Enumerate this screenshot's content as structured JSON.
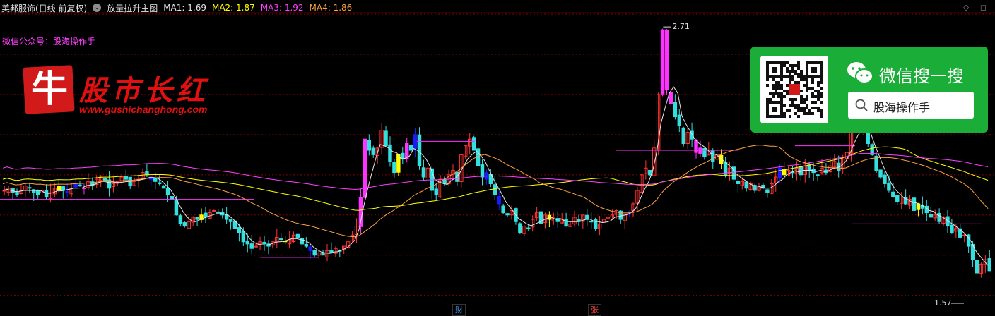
{
  "header": {
    "stock": "美邦服饰(日线 前复权)",
    "icon": "chevron-circle-icon",
    "indicator": "放量拉升主图",
    "ma": [
      {
        "label": "MA1: 1.69",
        "color": "#e6e6e6"
      },
      {
        "label": "MA2: 1.87",
        "color": "#ffff00"
      },
      {
        "label": "MA3: 1.92",
        "color": "#ff40ff"
      },
      {
        "label": "MA4: 1.86",
        "color": "#ffa040"
      }
    ]
  },
  "wechat_note": {
    "text": "微信公众号：股海操作手",
    "color": "#ff40ff"
  },
  "logo": {
    "char": "牛",
    "title": "股市长红",
    "url": "www.gushichanghong.com"
  },
  "wechat_card": {
    "title": "微信搜一搜",
    "search_text": "股海操作手"
  },
  "bottom_tags": [
    {
      "text": "财",
      "color": "#4aa0ff"
    },
    {
      "text": "张",
      "color": "#ff4040"
    }
  ],
  "colors": {
    "up": "#ff3333",
    "down": "#33e0e0",
    "grid": "#8b0000",
    "ma1": "#e6e6e6",
    "ma2": "#ffff00",
    "ma3": "#ff40ff",
    "ma4": "#ffa040",
    "sig_mag": "#ff33ff",
    "sig_blue": "#1a1aff",
    "sig_yellow": "#ffff00"
  },
  "chart_data": {
    "type": "candlestick",
    "ylim": [
      1.5,
      2.78
    ],
    "max_label": "2.71",
    "min_label": "1.57",
    "closes": [
      1.99,
      2.0,
      1.98,
      1.97,
      1.99,
      2.01,
      2.0,
      1.98,
      1.97,
      1.99,
      1.96,
      1.98,
      2.0,
      2.01,
      1.99,
      1.98,
      2.0,
      2.02,
      2.01,
      2.0,
      2.03,
      2.01,
      2.04,
      2.05,
      2.03,
      2.0,
      2.02,
      2.03,
      2.05,
      2.04,
      2.01,
      2.03,
      2.04,
      2.07,
      2.06,
      2.04,
      2.03,
      2.02,
      2.0,
      1.97,
      1.95,
      1.88,
      1.84,
      1.83,
      1.85,
      1.87,
      1.86,
      1.88,
      1.87,
      1.89,
      1.9,
      1.89,
      1.88,
      1.86,
      1.85,
      1.82,
      1.8,
      1.76,
      1.75,
      1.73,
      1.74,
      1.76,
      1.75,
      1.74,
      1.76,
      1.78,
      1.77,
      1.76,
      1.77,
      1.79,
      1.78,
      1.75,
      1.74,
      1.72,
      1.7,
      1.71,
      1.7,
      1.72,
      1.71,
      1.73,
      1.72,
      1.74,
      1.76,
      1.79,
      1.83,
      1.96,
      2.22,
      2.17,
      2.15,
      2.18,
      2.26,
      2.19,
      2.12,
      2.07,
      2.15,
      2.13,
      2.2,
      2.17,
      2.24,
      2.1,
      2.05,
      2.09,
      1.99,
      1.97,
      2.04,
      2.02,
      2.06,
      2.08,
      2.03,
      2.15,
      2.19,
      2.22,
      2.17,
      2.1,
      2.05,
      2.07,
      2.02,
      1.97,
      1.93,
      1.89,
      1.88,
      1.9,
      1.85,
      1.8,
      1.83,
      1.82,
      1.86,
      1.89,
      1.84,
      1.88,
      1.86,
      1.87,
      1.85,
      1.86,
      1.83,
      1.84,
      1.87,
      1.85,
      1.88,
      1.86,
      1.85,
      1.82,
      1.84,
      1.86,
      1.87,
      1.88,
      1.9,
      1.86,
      1.88,
      1.89,
      1.93,
      1.99,
      2.06,
      2.09,
      2.06,
      2.18,
      2.42,
      2.71,
      2.44,
      2.38,
      2.32,
      2.28,
      2.2,
      2.25,
      2.22,
      2.16,
      2.18,
      2.14,
      2.17,
      2.12,
      2.15,
      2.11,
      2.06,
      2.09,
      2.04,
      2.02,
      2.03,
      2.0,
      2.02,
      1.99,
      2.01,
      2.0,
      1.98,
      2.02,
      2.05,
      2.09,
      2.06,
      2.08,
      2.07,
      2.09,
      2.06,
      2.1,
      2.08,
      2.07,
      2.06,
      2.09,
      2.07,
      2.1,
      2.12,
      2.08,
      2.13,
      2.16,
      2.27,
      2.35,
      2.28,
      2.26,
      2.2,
      2.15,
      2.08,
      2.05,
      2.02,
      1.99,
      1.96,
      1.94,
      1.96,
      1.93,
      1.95,
      1.9,
      1.93,
      1.91,
      1.89,
      1.87,
      1.88,
      1.85,
      1.87,
      1.83,
      1.8,
      1.82,
      1.78,
      1.79,
      1.74,
      1.68,
      1.62,
      1.66,
      1.68,
      1.63
    ]
  }
}
